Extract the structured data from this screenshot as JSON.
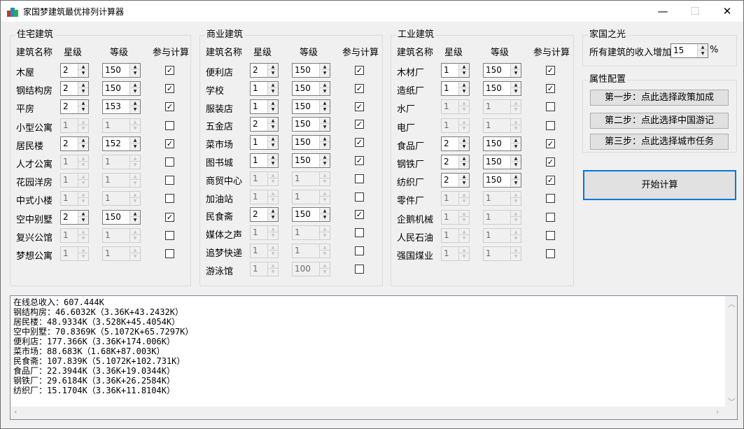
{
  "window": {
    "title": "家国梦建筑最优排列计算器"
  },
  "headers": {
    "name": "建筑名称",
    "star": "星级",
    "level": "等级",
    "include": "参与计算"
  },
  "residential": {
    "title": "住宅建筑",
    "rows": [
      {
        "name": "木屋",
        "star": "2",
        "level": "150",
        "checked": true,
        "enabled": true
      },
      {
        "name": "钢结构房",
        "star": "2",
        "level": "150",
        "checked": true,
        "enabled": true
      },
      {
        "name": "平房",
        "star": "2",
        "level": "153",
        "checked": true,
        "enabled": true
      },
      {
        "name": "小型公寓",
        "star": "1",
        "level": "1",
        "checked": false,
        "enabled": false
      },
      {
        "name": "居民楼",
        "star": "2",
        "level": "152",
        "checked": true,
        "enabled": true
      },
      {
        "name": "人才公寓",
        "star": "1",
        "level": "1",
        "checked": false,
        "enabled": false
      },
      {
        "name": "花园洋房",
        "star": "1",
        "level": "1",
        "checked": false,
        "enabled": false
      },
      {
        "name": "中式小楼",
        "star": "1",
        "level": "1",
        "checked": false,
        "enabled": false
      },
      {
        "name": "空中别墅",
        "star": "2",
        "level": "150",
        "checked": true,
        "enabled": true
      },
      {
        "name": "复兴公馆",
        "star": "1",
        "level": "1",
        "checked": false,
        "enabled": false
      },
      {
        "name": "梦想公寓",
        "star": "1",
        "level": "1",
        "checked": false,
        "enabled": false
      }
    ]
  },
  "commercial": {
    "title": "商业建筑",
    "rows": [
      {
        "name": "便利店",
        "star": "2",
        "level": "150",
        "checked": true,
        "enabled": true
      },
      {
        "name": "学校",
        "star": "1",
        "level": "150",
        "checked": true,
        "enabled": true
      },
      {
        "name": "服装店",
        "star": "1",
        "level": "150",
        "checked": true,
        "enabled": true
      },
      {
        "name": "五金店",
        "star": "2",
        "level": "150",
        "checked": true,
        "enabled": true
      },
      {
        "name": "菜市场",
        "star": "1",
        "level": "150",
        "checked": true,
        "enabled": true
      },
      {
        "name": "图书城",
        "star": "1",
        "level": "150",
        "checked": true,
        "enabled": true
      },
      {
        "name": "商贸中心",
        "star": "1",
        "level": "1",
        "checked": false,
        "enabled": false
      },
      {
        "name": "加油站",
        "star": "1",
        "level": "1",
        "checked": false,
        "enabled": false
      },
      {
        "name": "民食斋",
        "star": "2",
        "level": "150",
        "checked": true,
        "enabled": true
      },
      {
        "name": "媒体之声",
        "star": "1",
        "level": "1",
        "checked": false,
        "enabled": false
      },
      {
        "name": "追梦快递",
        "star": "1",
        "level": "1",
        "checked": false,
        "enabled": false
      },
      {
        "name": "游泳馆",
        "star": "1",
        "level": "100",
        "checked": false,
        "enabled": false
      }
    ]
  },
  "industrial": {
    "title": "工业建筑",
    "rows": [
      {
        "name": "木材厂",
        "star": "1",
        "level": "150",
        "checked": true,
        "enabled": true
      },
      {
        "name": "造纸厂",
        "star": "1",
        "level": "150",
        "checked": true,
        "enabled": true
      },
      {
        "name": "水厂",
        "star": "1",
        "level": "1",
        "checked": false,
        "enabled": false
      },
      {
        "name": "电厂",
        "star": "1",
        "level": "1",
        "checked": false,
        "enabled": false
      },
      {
        "name": "食品厂",
        "star": "2",
        "level": "150",
        "checked": true,
        "enabled": true
      },
      {
        "name": "钢铁厂",
        "star": "2",
        "level": "150",
        "checked": true,
        "enabled": true
      },
      {
        "name": "纺织厂",
        "star": "2",
        "level": "150",
        "checked": true,
        "enabled": true
      },
      {
        "name": "零件厂",
        "star": "1",
        "level": "1",
        "checked": false,
        "enabled": false
      },
      {
        "name": "企鹅机械",
        "star": "1",
        "level": "1",
        "checked": false,
        "enabled": false
      },
      {
        "name": "人民石油",
        "star": "1",
        "level": "1",
        "checked": false,
        "enabled": false
      },
      {
        "name": "强国煤业",
        "star": "1",
        "level": "1",
        "checked": false,
        "enabled": false
      }
    ]
  },
  "guoguang": {
    "title": "家国之光",
    "label": "所有建筑的收入增加",
    "value": "15",
    "unit": "%"
  },
  "config": {
    "title": "属性配置",
    "step1": "第一步：点此选择政策加成",
    "step2": "第二步：点此选择中国游记",
    "step3": "第三步：点此选择城市任务"
  },
  "calc_button": "开始计算",
  "output_lines": [
    "在线总收入：607.444K",
    "钢结构房：46.6032K（3.36K+43.2432K）",
    "居民楼：48.9334K（3.528K+45.4054K）",
    "空中别墅：70.8369K（5.1072K+65.7297K）",
    "便利店：177.366K（3.36K+174.006K）",
    "菜市场：88.683K（1.68K+87.003K）",
    "民食斋：107.839K（5.1072K+102.731K）",
    "食品厂：22.3944K（3.36K+19.0344K）",
    "钢铁厂：29.6184K（3.36K+26.2584K）",
    "纺织厂：15.1704K（3.36K+11.8104K）"
  ]
}
